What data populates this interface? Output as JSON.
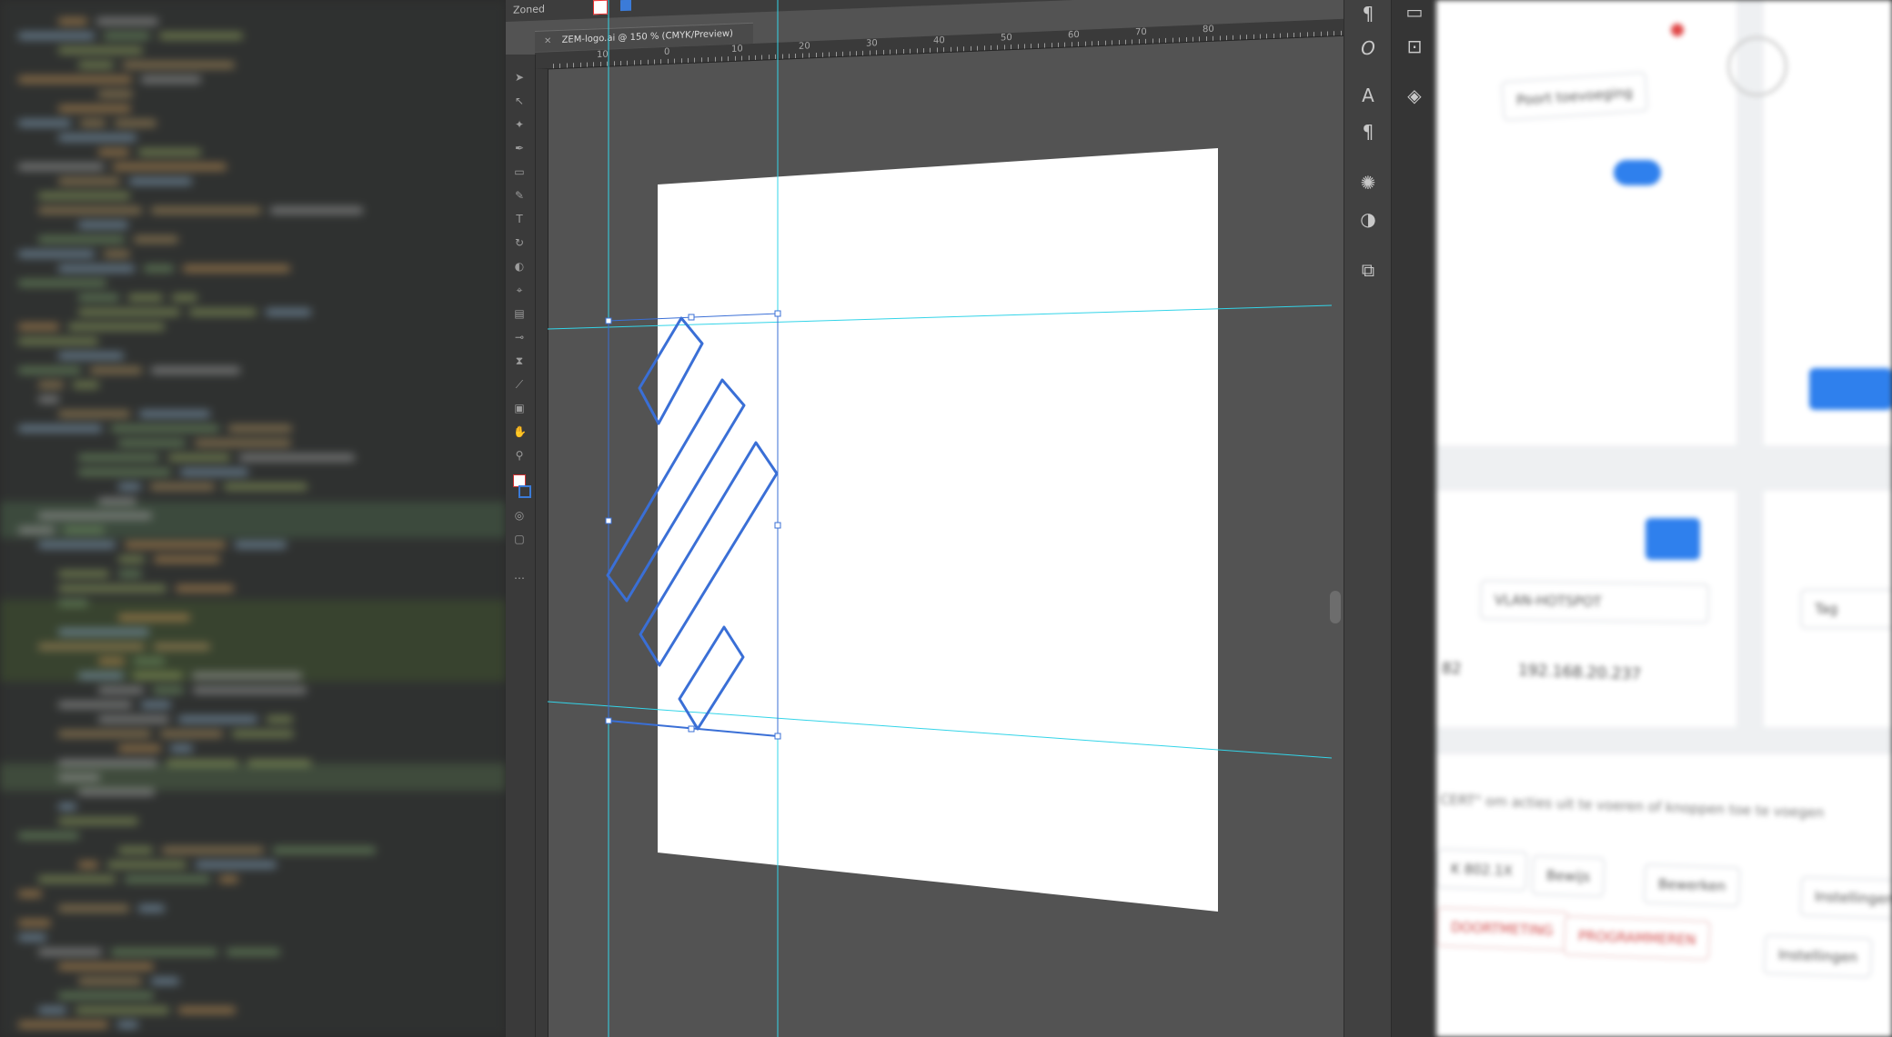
{
  "illustrator": {
    "menu_label": "Zoned",
    "document_tab": "ZEM-logo.ai @ 150 % (CMYK/Preview)",
    "tab_close": "×",
    "ruler_labels": [
      "10",
      "0",
      "10",
      "20",
      "30",
      "40",
      "50",
      "60",
      "70",
      "80"
    ]
  },
  "web_ui": {
    "port_button": "Poort toevoeging",
    "vlan_select": "VLAN-HOTSPOT",
    "ip_address": "192.168.20.237",
    "port_suffix": "82",
    "hint_text": "CERT\" om acties uit te voeren of knoppen toe te voegen",
    "buttons_row1": [
      "K 802.1X",
      "Bewijs",
      "Bewerken",
      "Instellingen"
    ],
    "buttons_row2": [
      "DOORTMETING",
      "PROGRAMMEREN",
      "Instellingen"
    ],
    "placeholder_right": "Tag"
  },
  "colors": {
    "guide": "#33d4e8",
    "logo_stroke": "#3a6fd6",
    "accent_blue": "#2f80ed"
  }
}
